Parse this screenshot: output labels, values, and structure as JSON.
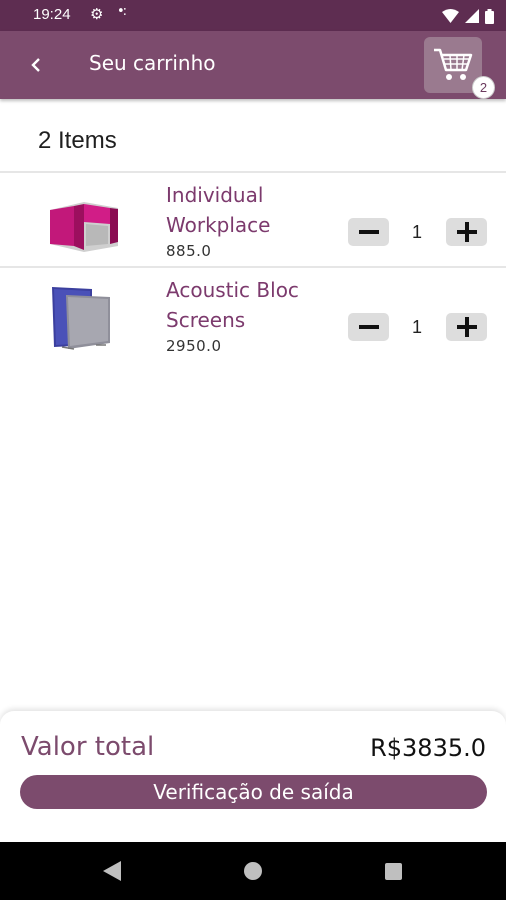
{
  "status_bar": {
    "time": "19:24",
    "icons": [
      "gear-icon",
      "dots-icon",
      "wifi-icon",
      "signal-icon",
      "battery-icon"
    ]
  },
  "app_bar": {
    "title": "Seu carrinho",
    "back_icon": "chevron-left-icon",
    "cart_icon": "cart-icon",
    "cart_badge": "2"
  },
  "items_count": "2 Items",
  "items": [
    {
      "name": "Individual Workplace",
      "price": "885.0",
      "quantity": "1",
      "thumb": "individual-workplace-image"
    },
    {
      "name": "Acoustic Bloc Screens",
      "price": "2950.0",
      "quantity": "1",
      "thumb": "acoustic-bloc-screens-image"
    }
  ],
  "footer": {
    "total_label": "Valor total",
    "total_value": "R$3835.0",
    "checkout_label": "Verificação de saída"
  },
  "colors": {
    "status_bar": "#5e2d51",
    "app_bar": "#7c4b6d",
    "accent_text": "#7c3a6d",
    "button_bg": "#dddddd"
  }
}
